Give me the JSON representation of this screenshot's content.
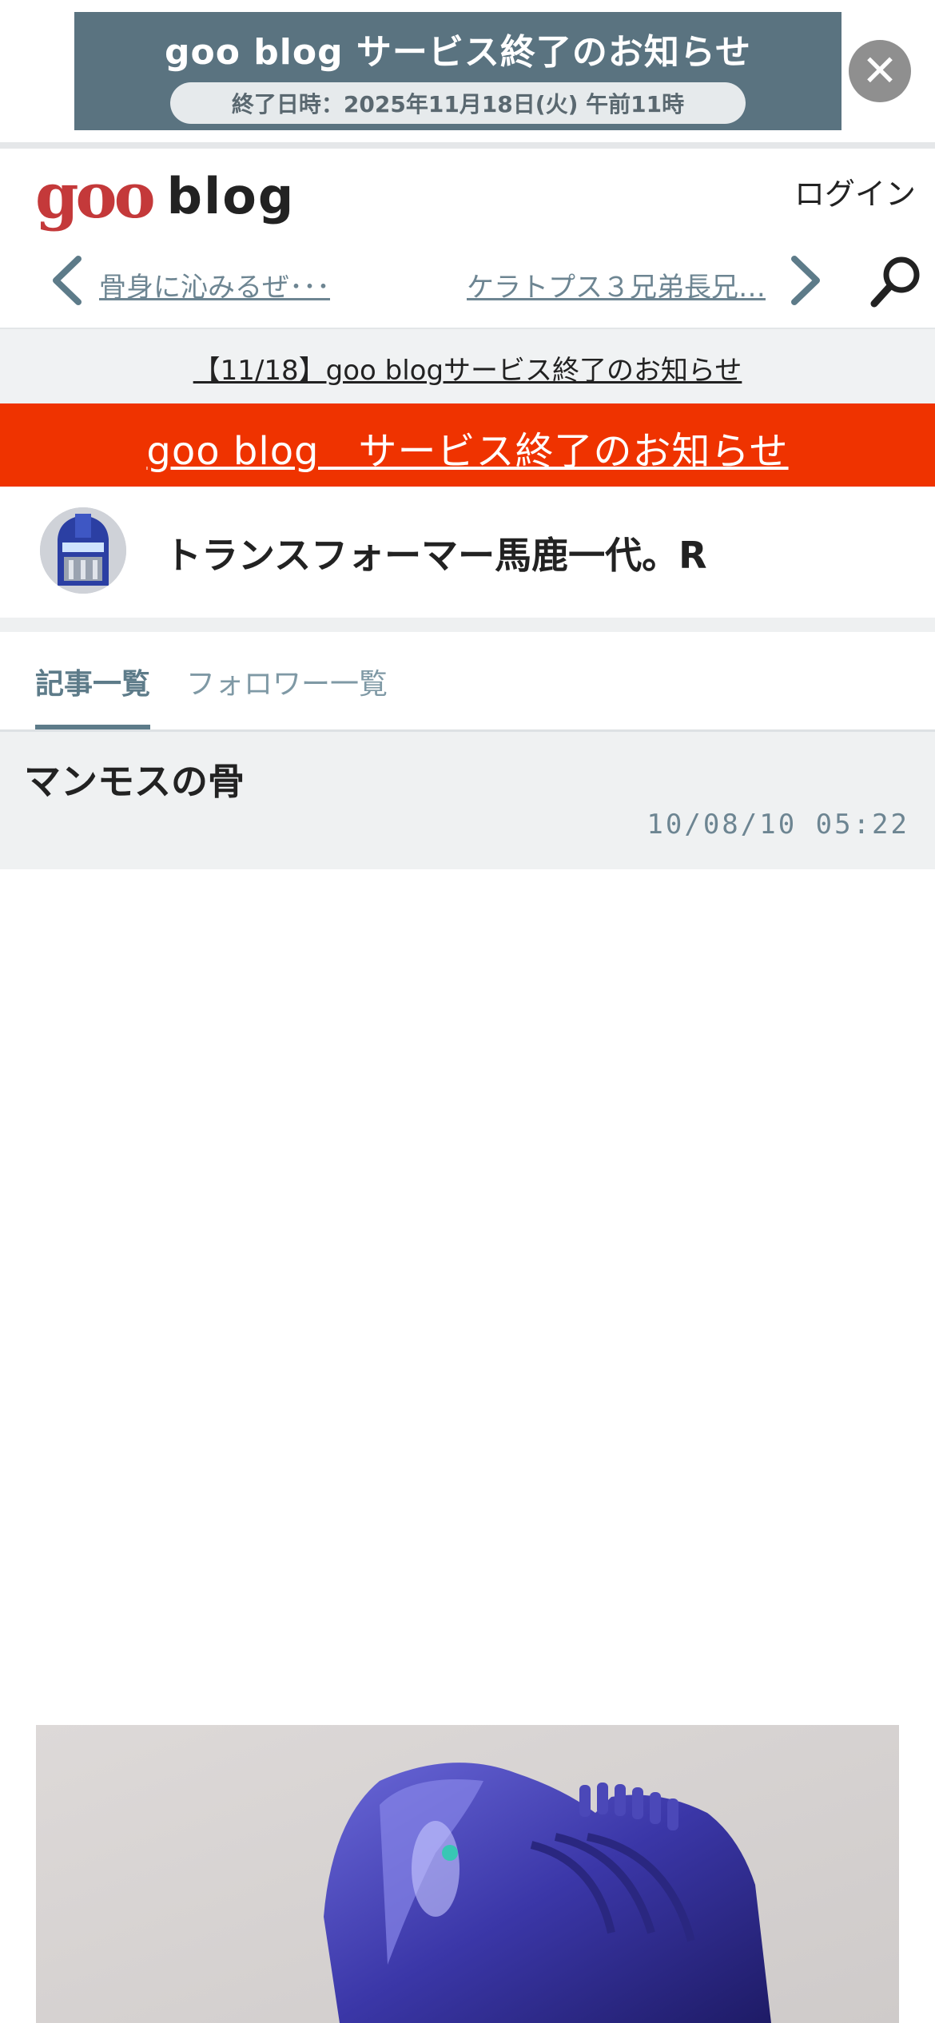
{
  "ad": {
    "title": "goo blog サービス終了のお知らせ",
    "subtitle": "終了日時：2025年11月18日(火) 午前11時",
    "close_icon": "close-icon"
  },
  "header": {
    "logo_goo": "goo",
    "logo_blog": "blog",
    "login": "ログイン",
    "prev_post": "骨身に沁みるぜ･･･",
    "next_post": "ケラトプス３兄弟長兄…",
    "icons": [
      "chevron-left-icon",
      "chevron-right-icon",
      "search-icon"
    ]
  },
  "notice": {
    "text": "【11/18】goo blogサービス終了のお知らせ"
  },
  "red_banner": {
    "text": "goo blog　サービス終了のお知らせ"
  },
  "blog": {
    "title": "トランスフォーマー馬鹿一代。R"
  },
  "tabs": [
    {
      "label": "記事一覧",
      "active": true
    },
    {
      "label": "フォロワー一覧",
      "active": false
    }
  ],
  "post": {
    "title": "マンモスの骨",
    "date": "10/08/10 05:22"
  },
  "colors": {
    "accent": "#5d7b89",
    "red_banner": "#ef3300",
    "logo_red": "#c4393a",
    "ad_bg": "#5a7380"
  }
}
